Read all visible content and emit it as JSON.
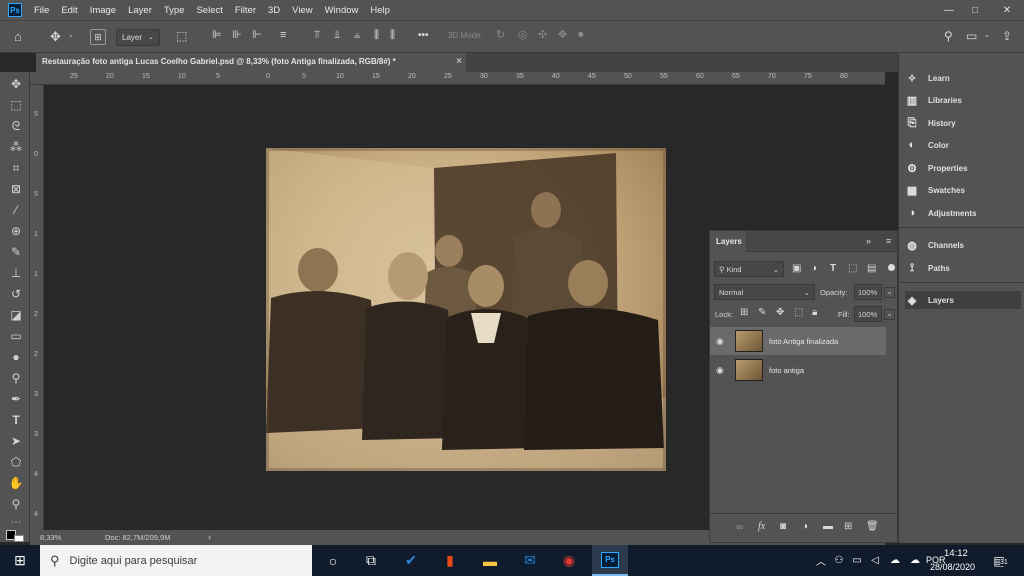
{
  "menubar": {
    "logo": "Ps",
    "items": [
      "File",
      "Edit",
      "Image",
      "Layer",
      "Type",
      "Select",
      "Filter",
      "3D",
      "View",
      "Window",
      "Help"
    ],
    "window_controls": [
      "—",
      "□",
      "✕"
    ]
  },
  "options_bar": {
    "layer_dropdown": "Layer",
    "more": "•••",
    "mode_3d": "3D Mode:"
  },
  "document": {
    "tab_title": "Restauração foto antiga Lucas Coelho Gabriel.psd @ 8,33% (foto Antiga finalizada, RGB/8#) *",
    "tab_close": "×"
  },
  "rulers": {
    "top": [
      "25",
      "20",
      "15",
      "10",
      "5",
      "0",
      "5",
      "10",
      "15",
      "20",
      "25",
      "30",
      "35",
      "40",
      "45",
      "50",
      "55",
      "60",
      "65",
      "70",
      "75",
      "80"
    ],
    "left": [
      "5",
      "0",
      "5",
      "1",
      "1",
      "2",
      "2",
      "3",
      "3",
      "4",
      "4"
    ]
  },
  "status": {
    "zoom": "8,33%",
    "doc": "Doc: 82,7M/209,9M",
    "arrow": "›"
  },
  "right_panel": {
    "group1": [
      {
        "label": "Learn",
        "icon": "lightbulb-icon"
      },
      {
        "label": "Libraries",
        "icon": "libraries-icon"
      },
      {
        "label": "History",
        "icon": "history-icon"
      },
      {
        "label": "Color",
        "icon": "palette-icon"
      },
      {
        "label": "Properties",
        "icon": "properties-icon"
      },
      {
        "label": "Swatches",
        "icon": "grid-icon"
      },
      {
        "label": "Adjustments",
        "icon": "half-circle-icon"
      }
    ],
    "group2": [
      {
        "label": "Channels",
        "icon": "channels-icon"
      },
      {
        "label": "Paths",
        "icon": "paths-icon"
      }
    ],
    "group3": [
      {
        "label": "Layers",
        "icon": "layers-icon"
      }
    ]
  },
  "layers_panel": {
    "title": "Layers",
    "filter_kind": "Kind",
    "blend_mode": "Normal",
    "opacity_label": "Opacity:",
    "opacity_value": "100%",
    "lock_label": "Lock:",
    "fill_label": "Fill:",
    "fill_value": "100%",
    "layers": [
      {
        "name": "foto Antiga finalizada",
        "selected": true
      },
      {
        "name": "foto antiga",
        "selected": false
      }
    ],
    "footer_icons": [
      "link-icon",
      "fx-icon",
      "mask-icon",
      "adjustment-icon",
      "folder-icon",
      "new-layer-icon",
      "trash-icon"
    ],
    "fx_label": "fx"
  },
  "taskbar": {
    "search_placeholder": "Digite aqui para pesquisar",
    "lang": "POR",
    "time": "14:12",
    "date": "28/08/2020",
    "notification_count": "31"
  }
}
